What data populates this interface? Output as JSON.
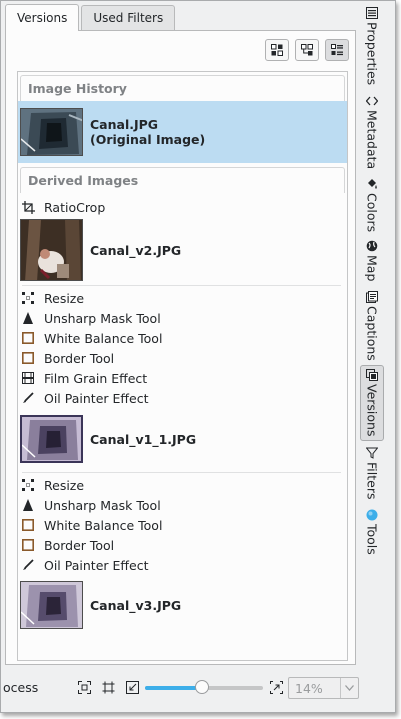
{
  "tabs": [
    {
      "label": "Versions",
      "active": true
    },
    {
      "label": "Used Filters",
      "active": false
    }
  ],
  "view_buttons": [
    {
      "icon": "grid-icon"
    },
    {
      "icon": "tree-icon"
    },
    {
      "icon": "list-icon",
      "active": true
    }
  ],
  "image_history": {
    "header": "Image History",
    "original": {
      "name": "Canal.JPG",
      "subtitle": "(Original Image)"
    }
  },
  "derived_images": {
    "header": "Derived Images",
    "groups": [
      {
        "filters": [
          {
            "icon": "crop-icon",
            "label": "RatioCrop"
          }
        ],
        "version": {
          "name": "Canal_v2.JPG"
        }
      },
      {
        "filters": [
          {
            "icon": "resize-icon",
            "label": "Resize"
          },
          {
            "icon": "sharpen-icon",
            "label": "Unsharp Mask Tool"
          },
          {
            "icon": "square-icon",
            "label": "White Balance Tool"
          },
          {
            "icon": "square-icon",
            "label": "Border Tool"
          },
          {
            "icon": "film-icon",
            "label": "Film Grain Effect"
          },
          {
            "icon": "brush-icon",
            "label": "Oil Painter Effect"
          }
        ],
        "version": {
          "name": "Canal_v1_1.JPG"
        }
      },
      {
        "filters": [
          {
            "icon": "resize-icon",
            "label": "Resize"
          },
          {
            "icon": "sharpen-icon",
            "label": "Unsharp Mask Tool"
          },
          {
            "icon": "square-icon",
            "label": "White Balance Tool"
          },
          {
            "icon": "square-icon",
            "label": "Border Tool"
          },
          {
            "icon": "brush-icon",
            "label": "Oil Painter Effect"
          }
        ],
        "version": {
          "name": "Canal_v3.JPG"
        }
      }
    ]
  },
  "sidebar": [
    {
      "label": "Properties",
      "icon": "properties-icon"
    },
    {
      "label": "Metadata",
      "icon": "metadata-icon"
    },
    {
      "label": "Colors",
      "icon": "colors-icon"
    },
    {
      "label": "Map",
      "icon": "globe-icon"
    },
    {
      "label": "Captions",
      "icon": "captions-icon"
    },
    {
      "label": "Versions",
      "icon": "versions-icon",
      "active": true
    },
    {
      "label": "Filters",
      "icon": "filter-icon"
    },
    {
      "label": "Tools",
      "icon": "tools-icon"
    }
  ],
  "statusbar": {
    "text": "ocess",
    "zoom": "14%",
    "zoom_slider_fraction": 0.48
  },
  "colors": {
    "selection": "#bcdcf2",
    "accent": "#3daee9",
    "border_tool": "#8a5a2b"
  }
}
